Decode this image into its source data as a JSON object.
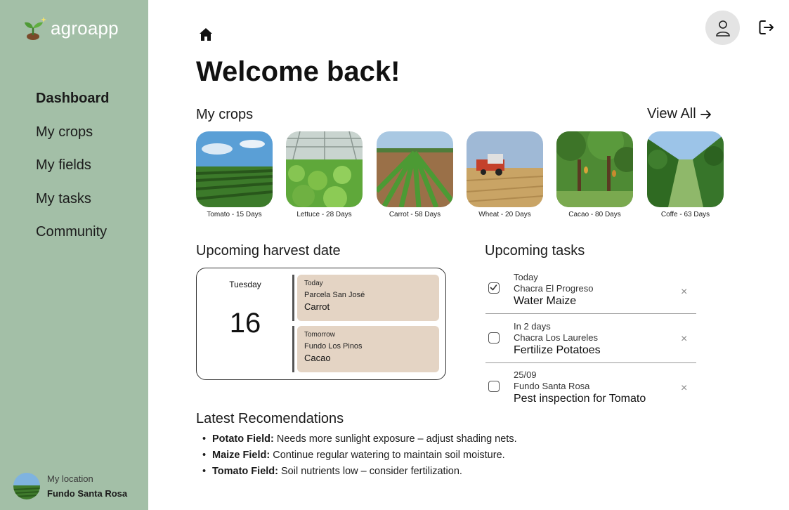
{
  "app": {
    "name": "agroapp"
  },
  "sidebar": {
    "items": [
      {
        "label": "Dashboard"
      },
      {
        "label": "My crops"
      },
      {
        "label": "My fields"
      },
      {
        "label": "My tasks"
      },
      {
        "label": "Community"
      }
    ],
    "location": {
      "label": "My location",
      "value": "Fundo Santa Rosa"
    }
  },
  "header": {
    "title": "Welcome back!"
  },
  "crops": {
    "title": "My crops",
    "view_all": "View All",
    "items": [
      {
        "label": "Tomato - 15 Days"
      },
      {
        "label": "Lettuce - 28 Days"
      },
      {
        "label": "Carrot - 58 Days"
      },
      {
        "label": "Wheat - 20 Days"
      },
      {
        "label": "Cacao - 80 Days"
      },
      {
        "label": "Coffe - 63 Days"
      }
    ]
  },
  "harvest": {
    "title": "Upcoming harvest date",
    "day_name": "Tuesday",
    "day_number": "16",
    "items": [
      {
        "when": "Today",
        "field": "Parcela San José",
        "crop": "Carrot"
      },
      {
        "when": "Tomorrow",
        "field": "Fundo Los Pinos",
        "crop": "Cacao"
      }
    ]
  },
  "tasks": {
    "title": "Upcoming tasks",
    "close_symbol": "×",
    "items": [
      {
        "when": "Today",
        "field": "Chacra El Progreso",
        "name": "Water Maize",
        "checked": true
      },
      {
        "when": "In 2 days",
        "field": "Chacra Los Laureles",
        "name": "Fertilize Potatoes",
        "checked": false
      },
      {
        "when": "25/09",
        "field": "Fundo Santa Rosa",
        "name": "Pest inspection for Tomato",
        "checked": false
      }
    ]
  },
  "recommendations": {
    "title": "Latest Recomendations",
    "items": [
      {
        "field": "Potato Field:",
        "text": " Needs more sunlight exposure – adjust shading nets."
      },
      {
        "field": "Maize Field:",
        "text": " Continue regular watering to maintain soil moisture."
      },
      {
        "field": "Tomato Field:",
        "text": " Soil nutrients low – consider fertilization."
      }
    ]
  },
  "colors": {
    "sidebar": "#a3bfa7",
    "harvest_box": "#e4d4c4",
    "user_button": "#e4e4e4"
  }
}
